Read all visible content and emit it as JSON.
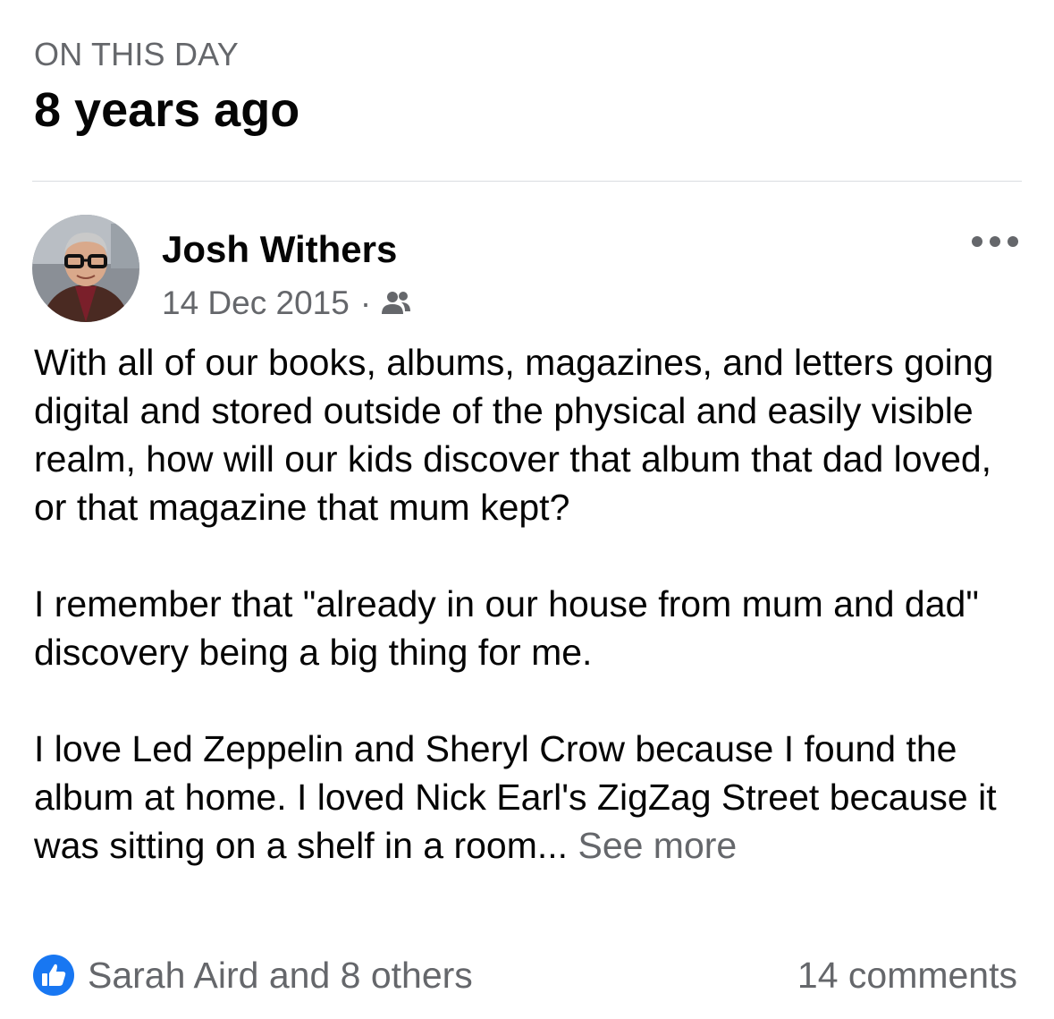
{
  "memory": {
    "label": "ON THIS DAY",
    "title": "8 years ago"
  },
  "post": {
    "author": "Josh Withers",
    "date": "14 Dec 2015",
    "separator": "·",
    "audience_icon": "friends-icon",
    "menu_icon": "more-horizontal-icon",
    "paragraphs": [
      "With all of our books, albums, magazines, and letters going digital and stored outside of the physical and easily visible realm, how will our kids discover that album that dad loved, or that magazine that mum kept?",
      "I remember that \"already in our house from mum and dad\" discovery being a big thing for me.",
      "I love Led Zeppelin and Sheryl Crow because I found the album at home. I loved Nick Earl's ZigZag Street because it was sitting on a shelf in a room... "
    ],
    "see_more": "See more",
    "reactions_text": "Sarah Aird and 8 others",
    "reaction_icon": "like-icon",
    "comments_text": "14 comments"
  },
  "colors": {
    "primary_text": "#050505",
    "secondary_text": "#65676b",
    "divider": "#dadde1",
    "like_blue": "#1877f2"
  }
}
